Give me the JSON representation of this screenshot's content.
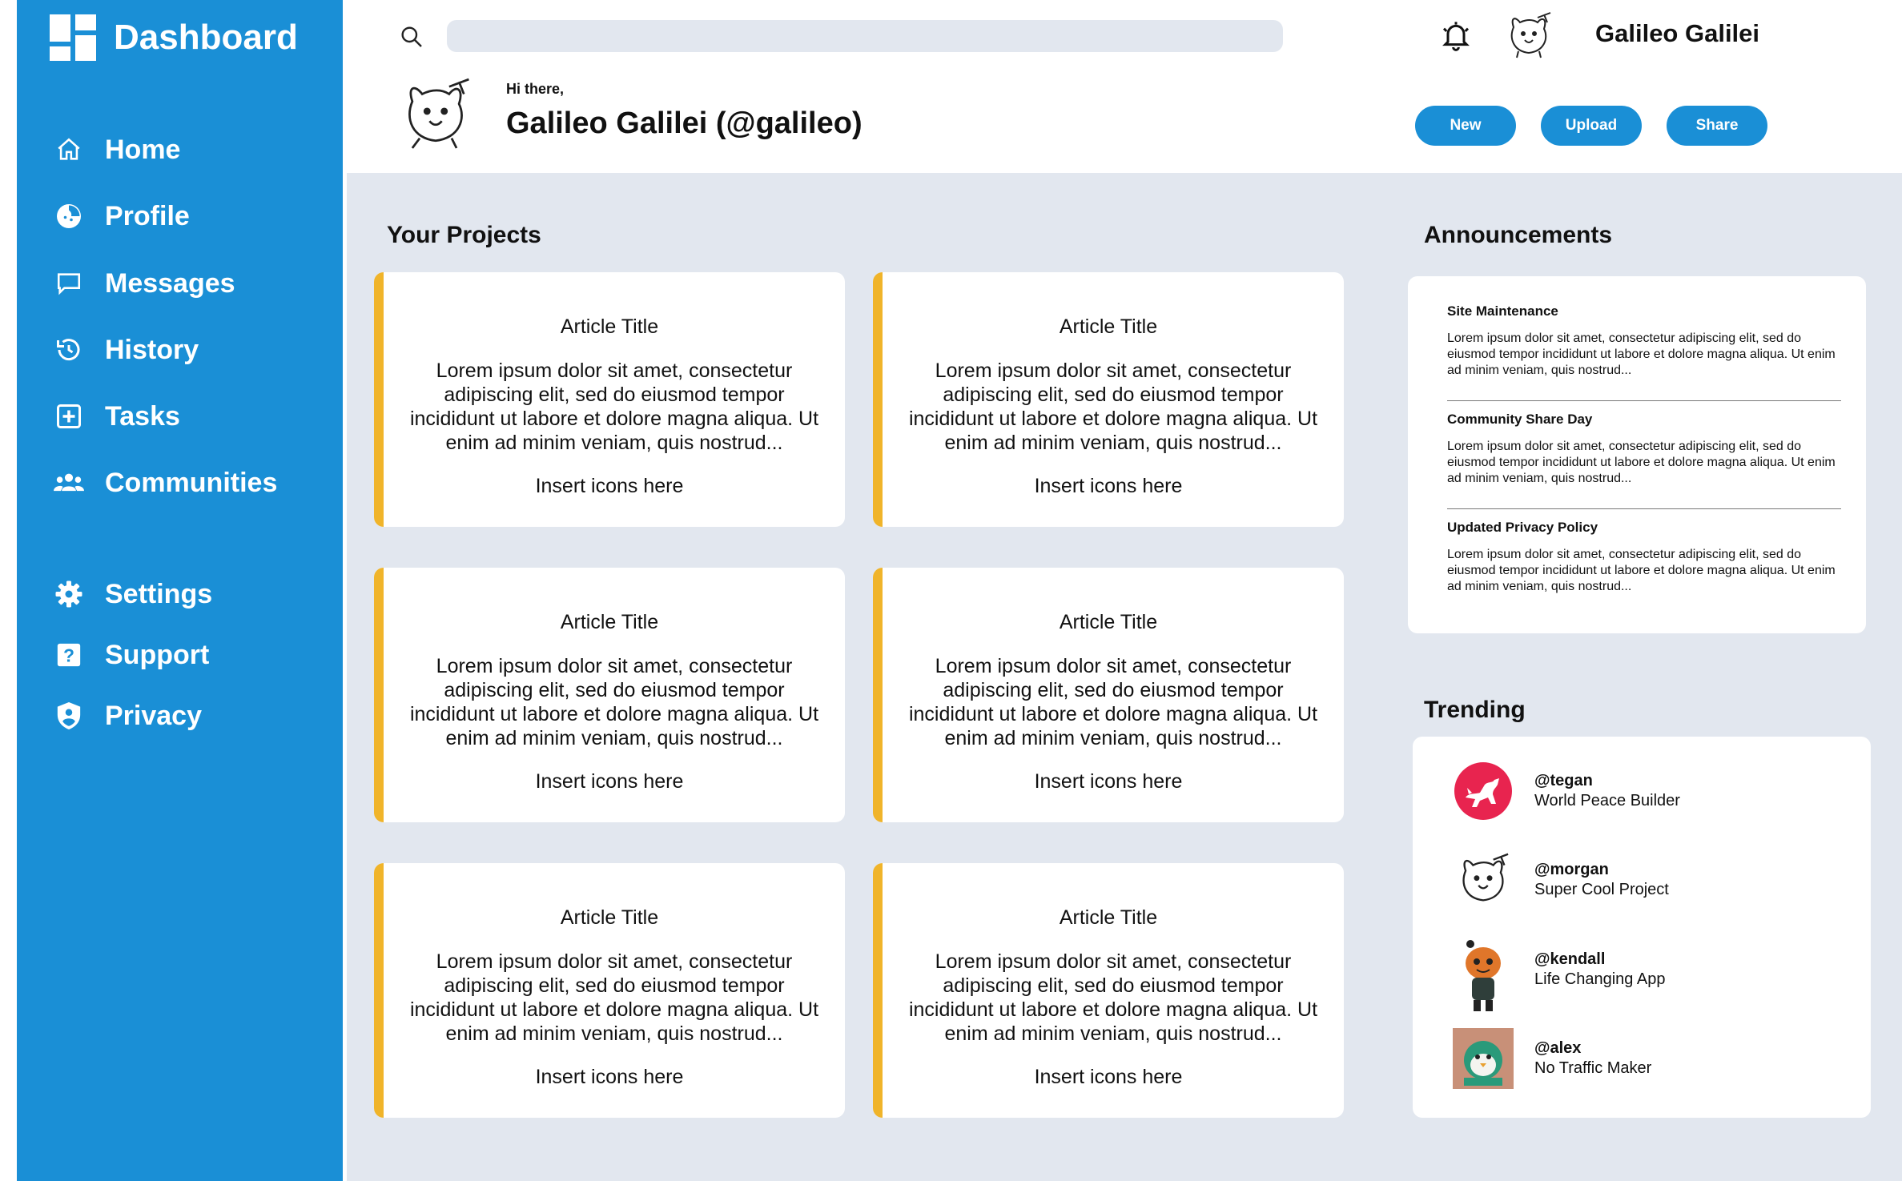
{
  "sidebar": {
    "brand": "Dashboard",
    "items": [
      {
        "label": "Home",
        "icon": "home-icon"
      },
      {
        "label": "Profile",
        "icon": "profile-icon"
      },
      {
        "label": "Messages",
        "icon": "message-icon"
      },
      {
        "label": "History",
        "icon": "history-icon"
      },
      {
        "label": "Tasks",
        "icon": "add-task-icon"
      },
      {
        "label": "Communities",
        "icon": "people-icon"
      },
      {
        "label": "Settings",
        "icon": "gear-icon"
      },
      {
        "label": "Support",
        "icon": "help-icon"
      },
      {
        "label": "Privacy",
        "icon": "shield-icon"
      }
    ]
  },
  "header": {
    "search_placeholder": "",
    "user_name": "Galileo Galilei"
  },
  "greeting": {
    "hello": "Hi there,",
    "name": "Galileo Galilei (@galileo)"
  },
  "actions": {
    "new_label": "New",
    "upload_label": "Upload",
    "share_label": "Share"
  },
  "projects": {
    "title": "Your Projects",
    "cards": [
      {
        "title": "Article Title",
        "body": "Lorem ipsum dolor sit amet, consectetur adipiscing elit, sed do eiusmod tempor incididunt ut labore et dolore magna aliqua. Ut enim ad minim veniam, quis nostrud...",
        "icons": "Insert icons here"
      },
      {
        "title": "Article Title",
        "body": "Lorem ipsum dolor sit amet, consectetur adipiscing elit, sed do eiusmod tempor incididunt ut labore et dolore magna aliqua. Ut enim ad minim veniam, quis nostrud...",
        "icons": "Insert icons here"
      },
      {
        "title": "Article Title",
        "body": "Lorem ipsum dolor sit amet, consectetur adipiscing elit, sed do eiusmod tempor incididunt ut labore et dolore magna aliqua. Ut enim ad minim veniam, quis nostrud...",
        "icons": "Insert icons here"
      },
      {
        "title": "Article Title",
        "body": "Lorem ipsum dolor sit amet, consectetur adipiscing elit, sed do eiusmod tempor incididunt ut labore et dolore magna aliqua. Ut enim ad minim veniam, quis nostrud...",
        "icons": "Insert icons here"
      },
      {
        "title": "Article Title",
        "body": "Lorem ipsum dolor sit amet, consectetur adipiscing elit, sed do eiusmod tempor incididunt ut labore et dolore magna aliqua. Ut enim ad minim veniam, quis nostrud...",
        "icons": "Insert icons here"
      },
      {
        "title": "Article Title",
        "body": "Lorem ipsum dolor sit amet, consectetur adipiscing elit, sed do eiusmod tempor incididunt ut labore et dolore magna aliqua. Ut enim ad minim veniam, quis nostrud...",
        "icons": "Insert icons here"
      }
    ]
  },
  "announcements": {
    "title": "Announcements",
    "items": [
      {
        "title": "Site Maintenance",
        "text": "Lorem ipsum dolor sit amet, consectetur adipiscing elit, sed do eiusmod tempor incididunt ut labore et dolore magna aliqua. Ut enim ad minim veniam, quis nostrud..."
      },
      {
        "title": "Community Share Day",
        "text": "Lorem ipsum dolor sit amet, consectetur adipiscing elit, sed do eiusmod tempor incididunt ut labore et dolore magna aliqua. Ut enim ad minim veniam, quis nostrud..."
      },
      {
        "title": "Updated Privacy Policy",
        "text": "Lorem ipsum dolor sit amet, consectetur adipiscing elit, sed do eiusmod tempor incididunt ut labore et dolore magna aliqua. Ut enim ad minim veniam, quis nostrud..."
      }
    ]
  },
  "trending": {
    "title": "Trending",
    "items": [
      {
        "handle": "@tegan",
        "desc": "World Peace Builder",
        "avatar": "dog-avatar-icon"
      },
      {
        "handle": "@morgan",
        "desc": "Super Cool Project",
        "avatar": "cat-avatar-icon"
      },
      {
        "handle": "@kendall",
        "desc": "Life Changing App",
        "avatar": "character-avatar-icon"
      },
      {
        "handle": "@alex",
        "desc": "No Traffic Maker",
        "avatar": "penguin-avatar-icon"
      }
    ]
  },
  "colors": {
    "sidebar": "#1a8fd6",
    "accent": "#f0b42a",
    "content_bg": "#e2e7ef",
    "button": "#1a8fd6"
  }
}
